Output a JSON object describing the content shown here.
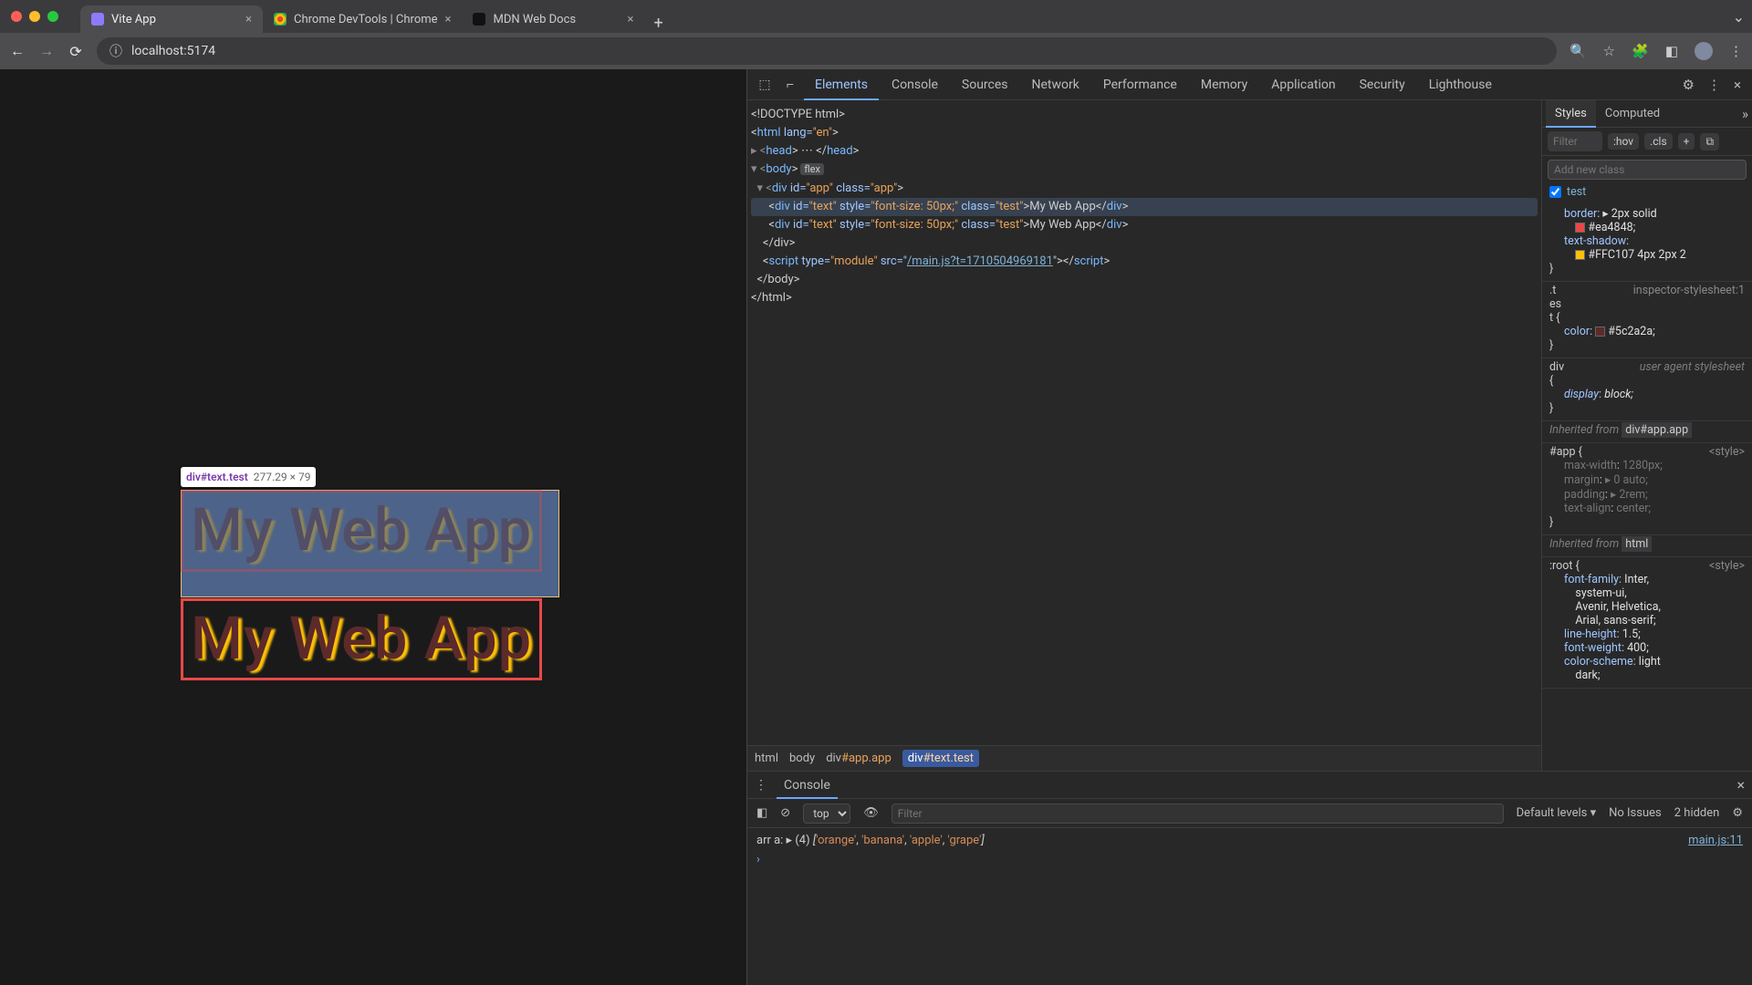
{
  "browser": {
    "tabs": [
      {
        "title": "Vite App",
        "favColor": "#8C7BFF"
      },
      {
        "title": "Chrome DevTools | Chrome",
        "favColor": "#34a853"
      },
      {
        "title": "MDN Web Docs",
        "favColor": "#111"
      }
    ],
    "url": "localhost:5174"
  },
  "inspector_tooltip": {
    "selector": "div#text.test",
    "dimensions": "277.29 × 79"
  },
  "preview": {
    "text1": "My Web App",
    "text2": "My Web App"
  },
  "devtools": {
    "tabs": [
      "Elements",
      "Console",
      "Sources",
      "Network",
      "Performance",
      "Memory",
      "Application",
      "Security",
      "Lighthouse"
    ],
    "activeTab": "Elements",
    "dom": {
      "l1": "<!DOCTYPE html>",
      "l2a": "<",
      "l2tag": "html",
      "l2attr": " lang=",
      "l2val": "\"en\"",
      "l2b": ">",
      "l3a": "▸ <",
      "l3tag": "head",
      "l3b": "> ",
      "l3dots": "⋯",
      "l3c": " </",
      "l3tag2": "head",
      "l3d": ">",
      "l4a": "▾ <",
      "l4tag": "body",
      "l4b": ">",
      "flex_badge": "flex",
      "l5a": "  ▾ <",
      "l5tag": "div",
      "l5attr1": " id=",
      "l5val1": "\"app\"",
      "l5attr2": " class=",
      "l5val2": "\"app\"",
      "l5b": ">",
      "l6a": "      <",
      "l6tag": "div",
      "l6attr1": " id=",
      "l6val1": "\"text\"",
      "l6attr2": " style=",
      "l6val2": "\"font-size: 50px;\"",
      "l6attr3": " class=",
      "l6val3": "\"test\"",
      "l6b": ">",
      "l6txt": "My Web App",
      "l6c": "</",
      "l6tag2": "div",
      "l6d": ">",
      "l7a": "      <",
      "l7tag": "div",
      "l7attr1": " id=",
      "l7val1": "\"text\"",
      "l7attr2": " style=",
      "l7val2": "\"font-size: 50px;\"",
      "l7attr3": " class=",
      "l7val3": "\"test\"",
      "l7b": ">",
      "l7txt": "My Web App",
      "l7c": "</",
      "l7tag2": "div",
      "l7d": ">",
      "l8": "    </div>",
      "l9a": "    <",
      "l9tag": "script",
      "l9attr1": " type=",
      "l9val1": "\"module\"",
      "l9attr2": " src=\"",
      "l9link": "/main.js?t=1710504969181",
      "l9b": "\"></",
      "l9tag2": "script",
      "l9c": ">",
      "l10": "  </body>",
      "l11": "</html>"
    },
    "breadcrumbs": [
      "html",
      "body",
      "div#app.app",
      "div#text.test"
    ]
  },
  "styles": {
    "tabs": [
      "Styles",
      "Computed"
    ],
    "filter_placeholder": "Filter",
    "hov": ":hov",
    "cls": ".cls",
    "add_class_placeholder": "Add new class",
    "checkbox_label": "test",
    "rules": {
      "r1": {
        "props": [
          {
            "p": "border",
            "v": "▸ 2px solid",
            "swatch": "#ea4848",
            "tail": "#ea4848;"
          },
          {
            "p": "text-shadow",
            "swatch": "#FFC107",
            "v": "#FFC107 4px 2px 2"
          }
        ]
      },
      "r2": {
        "selector": ".t\nes\nt {",
        "source": "inspector-stylesheet:1",
        "props": [
          {
            "p": "color",
            "swatch": "#5c2a2a",
            "v": "#5c2a2a;"
          }
        ]
      },
      "r3": {
        "selector": "div",
        "source": "user agent stylesheet",
        "props": [
          {
            "p": "display",
            "v": "block;",
            "italic": true
          }
        ]
      },
      "inh1_label": "Inherited from ",
      "inh1_el": "div#app.app",
      "r4": {
        "selector": "#app {",
        "source": "<style>",
        "props": [
          {
            "p": "max-width",
            "v": "1280px;",
            "inactive": true
          },
          {
            "p": "margin",
            "v": "▸ 0 auto;",
            "inactive": true
          },
          {
            "p": "padding",
            "v": "▸ 2rem;",
            "inactive": true
          },
          {
            "p": "text-align",
            "v": "center;",
            "inactive": true
          }
        ]
      },
      "inh2_label": "Inherited from ",
      "inh2_el": "html",
      "r5": {
        "selector": ":root {",
        "source": "<style>",
        "props": [
          {
            "p": "font-family",
            "v": "Inter,\n    system-ui,\n    Avenir, Helvetica,\n    Arial, sans-serif;"
          },
          {
            "p": "line-height",
            "v": "1.5;"
          },
          {
            "p": "font-weight",
            "v": "400;"
          },
          {
            "p": "color-scheme",
            "v": "light\n    dark;"
          }
        ]
      }
    }
  },
  "console": {
    "tab": "Console",
    "context": "top",
    "filter_placeholder": "Filter",
    "levels": "Default levels",
    "issues": "No Issues",
    "hidden": "2 hidden",
    "log_prefix": "arr a:",
    "log_count": "(4)",
    "log_items": [
      "'orange'",
      "'banana'",
      "'apple'",
      "'grape'"
    ],
    "log_source": "main.js:11"
  }
}
